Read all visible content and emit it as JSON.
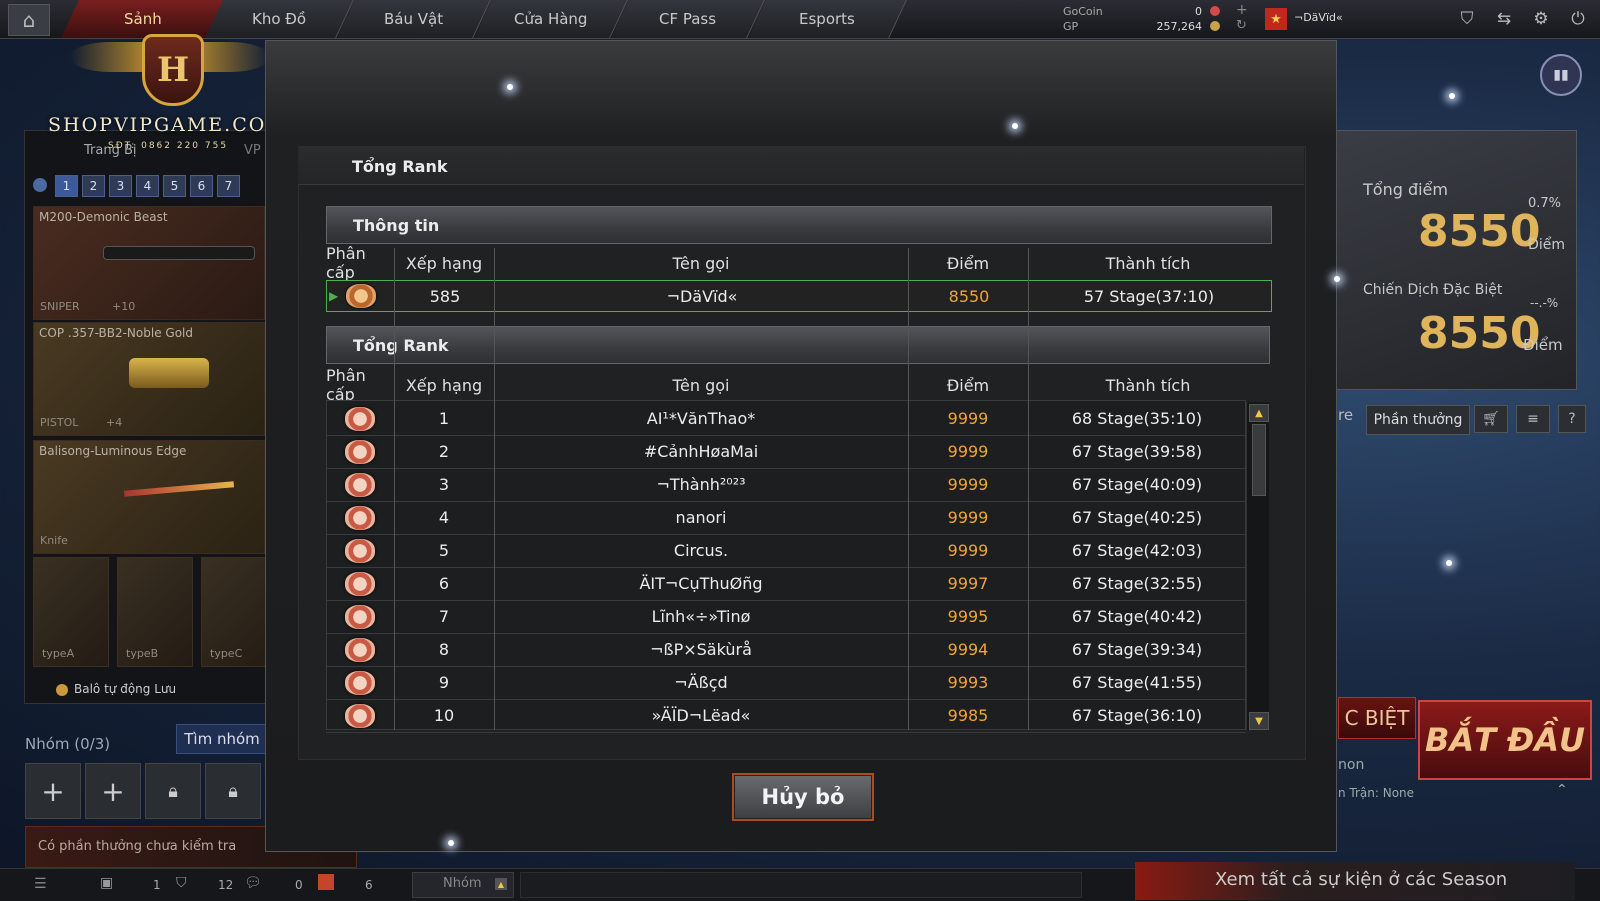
{
  "topbar": {
    "tabs": [
      "Sảnh",
      "Kho Đồ",
      "Báu Vật",
      "Cửa Hàng",
      "CF Pass",
      "Esports"
    ],
    "gocoin_label": "GoCoin",
    "gp_label": "GP",
    "gocoin_value": "0",
    "gp_value": "257,264",
    "player_name": "¬DäVïd«"
  },
  "logo": {
    "text": "SHOPVIPGAME.COM",
    "phone": "SĐT: 0862 220 755"
  },
  "left": {
    "tab_partial": "Trang Bị",
    "tab_vip": "VP",
    "slots": [
      "1",
      "2",
      "3",
      "4",
      "5",
      "6",
      "7"
    ],
    "weapons": [
      {
        "name": "M200-Demonic Beast",
        "type": "SNIPER",
        "plus": "+10"
      },
      {
        "name": "COP .357-BB2-Noble Gold",
        "type": "PISTOL",
        "plus": "+4"
      },
      {
        "name": "Balisong-Luminous Edge",
        "type": "Knife",
        "plus": ""
      }
    ],
    "small_items": [
      "typeA",
      "typeB",
      "typeC"
    ],
    "autosave": "Balô tự động Lưu",
    "group_label": "Nhóm (0/3)",
    "find_group": "Tìm nhóm",
    "reward_notice": "Có phần thưởng chưa kiểm tra"
  },
  "modal": {
    "title": "Tổng Rank",
    "info_header": "Thông tin",
    "ranking_header": "Tổng Rank",
    "columns": [
      "Phân cấp",
      "Xếp hạng",
      "Tên gọi",
      "Điểm",
      "Thành tích"
    ],
    "me": {
      "rank": "585",
      "name": "¬DäVïd«",
      "score": "8550",
      "achievement": "57 Stage(37:10)"
    },
    "rows": [
      {
        "rank": "1",
        "name": "AI¹*VănThao*",
        "score": "9999",
        "achievement": "68 Stage(35:10)"
      },
      {
        "rank": "2",
        "name": "#CảnhHøaMai",
        "score": "9999",
        "achievement": "67 Stage(39:58)"
      },
      {
        "rank": "3",
        "name": "¬Thành²⁰²³",
        "score": "9999",
        "achievement": "67 Stage(40:09)"
      },
      {
        "rank": "4",
        "name": "nanori",
        "score": "9999",
        "achievement": "67 Stage(40:25)"
      },
      {
        "rank": "5",
        "name": "Circus.",
        "score": "9999",
        "achievement": "67 Stage(42:03)"
      },
      {
        "rank": "6",
        "name": "ÄIT¬CụThuØñg",
        "score": "9997",
        "achievement": "67 Stage(32:55)"
      },
      {
        "rank": "7",
        "name": "Lĩnh«÷»Tinø",
        "score": "9995",
        "achievement": "67 Stage(40:42)"
      },
      {
        "rank": "8",
        "name": "¬ßP×Säkùrå",
        "score": "9994",
        "achievement": "67 Stage(39:34)"
      },
      {
        "rank": "9",
        "name": "¬Äßçd",
        "score": "9993",
        "achievement": "67 Stage(41:55)"
      },
      {
        "rank": "10",
        "name": "»ÄÏD¬Lëad«",
        "score": "9985",
        "achievement": "67 Stage(36:10)"
      }
    ],
    "cancel": "Hủy bỏ"
  },
  "right": {
    "total_label": "Tổng điểm",
    "total_pct": "0.7%",
    "total_score": "8550",
    "points_word": "Điểm",
    "special_label": "Chiến Dịch Đặc Biệt",
    "special_pct": "--.-%",
    "special_score": "8550",
    "reward_tab": "Phần thưởng",
    "partial_re": "re",
    "special_partial": "C BIỆT",
    "start": "BẮT ĐẦU",
    "partial_mon": "non",
    "match_info": "n Trận: None"
  },
  "bottom": {
    "count1": "1",
    "count2": "12",
    "count3": "0",
    "count4": "6",
    "chat_tab": "Nhóm",
    "season_text": "Xem tất cả sự kiện ở các Season"
  }
}
